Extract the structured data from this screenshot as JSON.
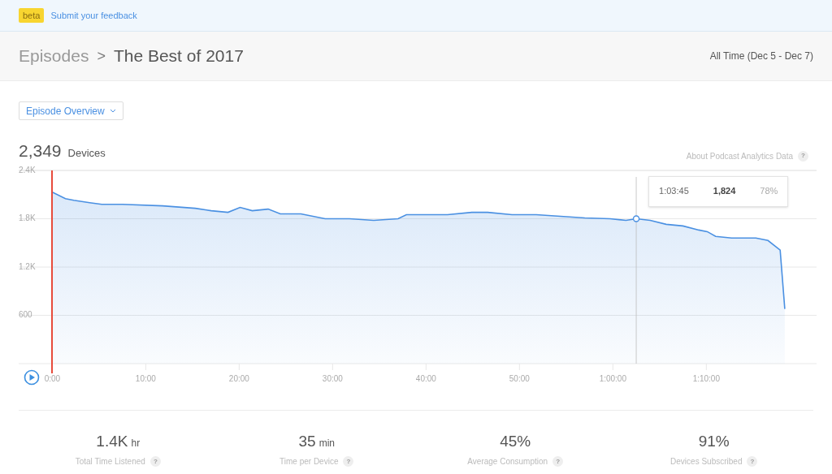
{
  "banner": {
    "badge": "beta",
    "link": "Submit your feedback"
  },
  "header": {
    "breadcrumb": "Episodes",
    "separator": ">",
    "title": "The Best of 2017",
    "range": "All Time (Dec 5 - Dec 7)"
  },
  "view_dropdown": {
    "value": "Episode Overview"
  },
  "summary": {
    "count": "2,349",
    "unit": "Devices",
    "about_link": "About Podcast Analytics Data",
    "help": "?"
  },
  "chart": {
    "tooltip": {
      "time": "1:03:45",
      "value": "1,824",
      "percent": "78%"
    },
    "chart_data": {
      "type": "area",
      "x": [
        0,
        1.4,
        2.3,
        4,
        5.3,
        7.5,
        11.8,
        15.3,
        17,
        18.8,
        20.1,
        21.4,
        23.1,
        24.4,
        26.6,
        29.2,
        31.8,
        34.4,
        37,
        37.9,
        42.3,
        44.9,
        46.6,
        49.2,
        51.8,
        54.4,
        57,
        59.7,
        61.4,
        62.5,
        64,
        65.7,
        67.5,
        69.2,
        70.1,
        71,
        72.7,
        75.3,
        76.6,
        77.9,
        78.4
      ],
      "series": [
        {
          "color": "#4a90e2",
          "values": [
            2130,
            2050,
            2030,
            2000,
            1980,
            1980,
            1960,
            1930,
            1900,
            1880,
            1940,
            1900,
            1920,
            1860,
            1860,
            1800,
            1800,
            1780,
            1800,
            1850,
            1850,
            1880,
            1880,
            1850,
            1850,
            1830,
            1810,
            1800,
            1780,
            1800,
            1780,
            1730,
            1710,
            1660,
            1640,
            1580,
            1560,
            1560,
            1530,
            1410,
            680
          ]
        }
      ],
      "ref_lines": [
        {
          "axis": "x",
          "value": 62.5
        }
      ],
      "xlim": [
        -3.6,
        81.8
      ],
      "ylim": [
        0,
        2400
      ],
      "grid": true,
      "xticks": [
        {
          "value": 0,
          "label": "0:00"
        },
        {
          "value": 10,
          "label": "10:00"
        },
        {
          "value": 20,
          "label": "20:00"
        },
        {
          "value": 30,
          "label": "30:00"
        },
        {
          "value": 40,
          "label": "40:00"
        },
        {
          "value": 50,
          "label": "50:00"
        },
        {
          "value": 60,
          "label": "1:00:00"
        },
        {
          "value": 70,
          "label": "1:10:00"
        }
      ],
      "yticks": [
        {
          "value": 600,
          "label": "600"
        },
        {
          "value": 1200,
          "label": "1.2K"
        },
        {
          "value": 1800,
          "label": "1.8K"
        },
        {
          "value": 2400,
          "label": "2.4K"
        }
      ]
    }
  },
  "stats": [
    {
      "value": "1.4K",
      "unit": "hr",
      "label": "Total Time Listened",
      "help": "?"
    },
    {
      "value": "35",
      "unit": "min",
      "label": "Time per Device",
      "help": "?"
    },
    {
      "value": "45%",
      "label": "Average Consumption",
      "help": "?"
    },
    {
      "value": "91%",
      "label": "Devices Subscribed",
      "help": "?"
    }
  ]
}
